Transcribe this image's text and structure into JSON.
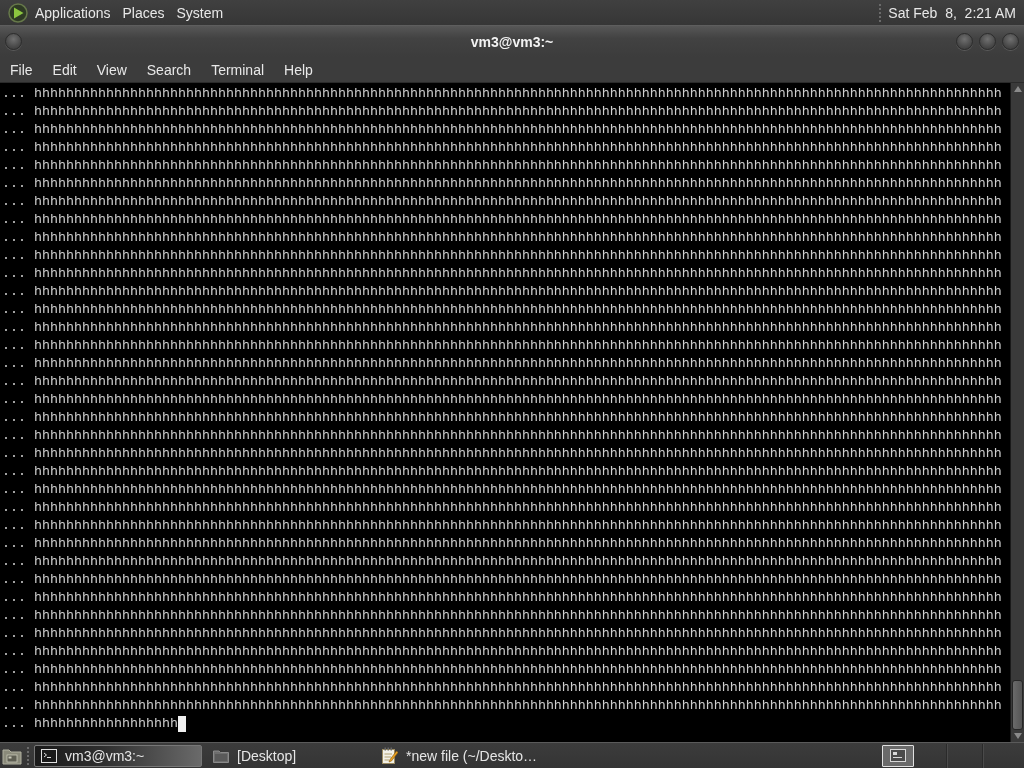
{
  "top_panel": {
    "menus": [
      "Applications",
      "Places",
      "System"
    ],
    "clock": "Sat Feb  8,  2:21 AM"
  },
  "window": {
    "title": "vm3@vm3:~"
  },
  "menu_bar": [
    "File",
    "Edit",
    "View",
    "Search",
    "Terminal",
    "Help"
  ],
  "terminal": {
    "lines": [
      {
        "text": "... hhhhhhhhhhhhhhhhhhhhhhhhhhhhhhhhhhhhhhhhhhhhhhhhhhhhhhhhhhhhhhhhhhhhhhhhhhhhhhhhhhhhhhhhhhhhhhhhhhhhhhhhhhhhhhhhhhhhhhhhh",
        "cursor": false
      },
      {
        "text": "... hhhhhhhhhhhhhhhhhhhhhhhhhhhhhhhhhhhhhhhhhhhhhhhhhhhhhhhhhhhhhhhhhhhhhhhhhhhhhhhhhhhhhhhhhhhhhhhhhhhhhhhhhhhhhhhhhhhhhhhhh",
        "cursor": false
      },
      {
        "text": "... hhhhhhhhhhhhhhhhhhhhhhhhhhhhhhhhhhhhhhhhhhhhhhhhhhhhhhhhhhhhhhhhhhhhhhhhhhhhhhhhhhhhhhhhhhhhhhhhhhhhhhhhhhhhhhhhhhhhhhhhh",
        "cursor": false
      },
      {
        "text": "... hhhhhhhhhhhhhhhhhhhhhhhhhhhhhhhhhhhhhhhhhhhhhhhhhhhhhhhhhhhhhhhhhhhhhhhhhhhhhhhhhhhhhhhhhhhhhhhhhhhhhhhhhhhhhhhhhhhhhhhhh",
        "cursor": false
      },
      {
        "text": "... hhhhhhhhhhhhhhhhhhhhhhhhhhhhhhhhhhhhhhhhhhhhhhhhhhhhhhhhhhhhhhhhhhhhhhhhhhhhhhhhhhhhhhhhhhhhhhhhhhhhhhhhhhhhhhhhhhhhhhhhh",
        "cursor": false
      },
      {
        "text": "... hhhhhhhhhhhhhhhhhhhhhhhhhhhhhhhhhhhhhhhhhhhhhhhhhhhhhhhhhhhhhhhhhhhhhhhhhhhhhhhhhhhhhhhhhhhhhhhhhhhhhhhhhhhhhhhhhhhhhhhhh",
        "cursor": false
      },
      {
        "text": "... hhhhhhhhhhhhhhhhhhhhhhhhhhhhhhhhhhhhhhhhhhhhhhhhhhhhhhhhhhhhhhhhhhhhhhhhhhhhhhhhhhhhhhhhhhhhhhhhhhhhhhhhhhhhhhhhhhhhhhhhh",
        "cursor": false
      },
      {
        "text": "... hhhhhhhhhhhhhhhhhhhhhhhhhhhhhhhhhhhhhhhhhhhhhhhhhhhhhhhhhhhhhhhhhhhhhhhhhhhhhhhhhhhhhhhhhhhhhhhhhhhhhhhhhhhhhhhhhhhhhhhhh",
        "cursor": false
      },
      {
        "text": "... hhhhhhhhhhhhhhhhhhhhhhhhhhhhhhhhhhhhhhhhhhhhhhhhhhhhhhhhhhhhhhhhhhhhhhhhhhhhhhhhhhhhhhhhhhhhhhhhhhhhhhhhhhhhhhhhhhhhhhhhh",
        "cursor": false
      },
      {
        "text": "... hhhhhhhhhhhhhhhhhhhhhhhhhhhhhhhhhhhhhhhhhhhhhhhhhhhhhhhhhhhhhhhhhhhhhhhhhhhhhhhhhhhhhhhhhhhhhhhhhhhhhhhhhhhhhhhhhhhhhhhhh",
        "cursor": false
      },
      {
        "text": "... hhhhhhhhhhhhhhhhhhhhhhhhhhhhhhhhhhhhhhhhhhhhhhhhhhhhhhhhhhhhhhhhhhhhhhhhhhhhhhhhhhhhhhhhhhhhhhhhhhhhhhhhhhhhhhhhhhhhhhhhh",
        "cursor": false
      },
      {
        "text": "... hhhhhhhhhhhhhhhhhhhhhhhhhhhhhhhhhhhhhhhhhhhhhhhhhhhhhhhhhhhhhhhhhhhhhhhhhhhhhhhhhhhhhhhhhhhhhhhhhhhhhhhhhhhhhhhhhhhhhhhhh",
        "cursor": false
      },
      {
        "text": "... hhhhhhhhhhhhhhhhhhhhhhhhhhhhhhhhhhhhhhhhhhhhhhhhhhhhhhhhhhhhhhhhhhhhhhhhhhhhhhhhhhhhhhhhhhhhhhhhhhhhhhhhhhhhhhhhhhhhhhhhh",
        "cursor": false
      },
      {
        "text": "... hhhhhhhhhhhhhhhhhhhhhhhhhhhhhhhhhhhhhhhhhhhhhhhhhhhhhhhhhhhhhhhhhhhhhhhhhhhhhhhhhhhhhhhhhhhhhhhhhhhhhhhhhhhhhhhhhhhhhhhhh",
        "cursor": false
      },
      {
        "text": "... hhhhhhhhhhhhhhhhhhhhhhhhhhhhhhhhhhhhhhhhhhhhhhhhhhhhhhhhhhhhhhhhhhhhhhhhhhhhhhhhhhhhhhhhhhhhhhhhhhhhhhhhhhhhhhhhhhhhhhhhh",
        "cursor": false
      },
      {
        "text": "... hhhhhhhhhhhhhhhhhhhhhhhhhhhhhhhhhhhhhhhhhhhhhhhhhhhhhhhhhhhhhhhhhhhhhhhhhhhhhhhhhhhhhhhhhhhhhhhhhhhhhhhhhhhhhhhhhhhhhhhhh",
        "cursor": false
      },
      {
        "text": "... hhhhhhhhhhhhhhhhhhhhhhhhhhhhhhhhhhhhhhhhhhhhhhhhhhhhhhhhhhhhhhhhhhhhhhhhhhhhhhhhhhhhhhhhhhhhhhhhhhhhhhhhhhhhhhhhhhhhhhhhh",
        "cursor": false
      },
      {
        "text": "... hhhhhhhhhhhhhhhhhhhhhhhhhhhhhhhhhhhhhhhhhhhhhhhhhhhhhhhhhhhhhhhhhhhhhhhhhhhhhhhhhhhhhhhhhhhhhhhhhhhhhhhhhhhhhhhhhhhhhhhhh",
        "cursor": false
      },
      {
        "text": "... hhhhhhhhhhhhhhhhhhhhhhhhhhhhhhhhhhhhhhhhhhhhhhhhhhhhhhhhhhhhhhhhhhhhhhhhhhhhhhhhhhhhhhhhhhhhhhhhhhhhhhhhhhhhhhhhhhhhhhhhh",
        "cursor": false
      },
      {
        "text": "... hhhhhhhhhhhhhhhhhhhhhhhhhhhhhhhhhhhhhhhhhhhhhhhhhhhhhhhhhhhhhhhhhhhhhhhhhhhhhhhhhhhhhhhhhhhhhhhhhhhhhhhhhhhhhhhhhhhhhhhhh",
        "cursor": false
      },
      {
        "text": "... hhhhhhhhhhhhhhhhhhhhhhhhhhhhhhhhhhhhhhhhhhhhhhhhhhhhhhhhhhhhhhhhhhhhhhhhhhhhhhhhhhhhhhhhhhhhhhhhhhhhhhhhhhhhhhhhhhhhhhhhh",
        "cursor": false
      },
      {
        "text": "... hhhhhhhhhhhhhhhhhhhhhhhhhhhhhhhhhhhhhhhhhhhhhhhhhhhhhhhhhhhhhhhhhhhhhhhhhhhhhhhhhhhhhhhhhhhhhhhhhhhhhhhhhhhhhhhhhhhhhhhhh",
        "cursor": false
      },
      {
        "text": "... hhhhhhhhhhhhhhhhhhhhhhhhhhhhhhhhhhhhhhhhhhhhhhhhhhhhhhhhhhhhhhhhhhhhhhhhhhhhhhhhhhhhhhhhhhhhhhhhhhhhhhhhhhhhhhhhhhhhhhhhh",
        "cursor": false
      },
      {
        "text": "... hhhhhhhhhhhhhhhhhhhhhhhhhhhhhhhhhhhhhhhhhhhhhhhhhhhhhhhhhhhhhhhhhhhhhhhhhhhhhhhhhhhhhhhhhhhhhhhhhhhhhhhhhhhhhhhhhhhhhhhhh",
        "cursor": false
      },
      {
        "text": "... hhhhhhhhhhhhhhhhhhhhhhhhhhhhhhhhhhhhhhhhhhhhhhhhhhhhhhhhhhhhhhhhhhhhhhhhhhhhhhhhhhhhhhhhhhhhhhhhhhhhhhhhhhhhhhhhhhhhhhhhh",
        "cursor": false
      },
      {
        "text": "... hhhhhhhhhhhhhhhhhhhhhhhhhhhhhhhhhhhhhhhhhhhhhhhhhhhhhhhhhhhhhhhhhhhhhhhhhhhhhhhhhhhhhhhhhhhhhhhhhhhhhhhhhhhhhhhhhhhhhhhhh",
        "cursor": false
      },
      {
        "text": "... hhhhhhhhhhhhhhhhhhhhhhhhhhhhhhhhhhhhhhhhhhhhhhhhhhhhhhhhhhhhhhhhhhhhhhhhhhhhhhhhhhhhhhhhhhhhhhhhhhhhhhhhhhhhhhhhhhhhhhhhh",
        "cursor": false
      },
      {
        "text": "... hhhhhhhhhhhhhhhhhhhhhhhhhhhhhhhhhhhhhhhhhhhhhhhhhhhhhhhhhhhhhhhhhhhhhhhhhhhhhhhhhhhhhhhhhhhhhhhhhhhhhhhhhhhhhhhhhhhhhhhhh",
        "cursor": false
      },
      {
        "text": "... hhhhhhhhhhhhhhhhhhhhhhhhhhhhhhhhhhhhhhhhhhhhhhhhhhhhhhhhhhhhhhhhhhhhhhhhhhhhhhhhhhhhhhhhhhhhhhhhhhhhhhhhhhhhhhhhhhhhhhhhh",
        "cursor": false
      },
      {
        "text": "... hhhhhhhhhhhhhhhhhhhhhhhhhhhhhhhhhhhhhhhhhhhhhhhhhhhhhhhhhhhhhhhhhhhhhhhhhhhhhhhhhhhhhhhhhhhhhhhhhhhhhhhhhhhhhhhhhhhhhhhhh",
        "cursor": false
      },
      {
        "text": "... hhhhhhhhhhhhhhhhhhhhhhhhhhhhhhhhhhhhhhhhhhhhhhhhhhhhhhhhhhhhhhhhhhhhhhhhhhhhhhhhhhhhhhhhhhhhhhhhhhhhhhhhhhhhhhhhhhhhhhhhh",
        "cursor": false
      },
      {
        "text": "... hhhhhhhhhhhhhhhhhhhhhhhhhhhhhhhhhhhhhhhhhhhhhhhhhhhhhhhhhhhhhhhhhhhhhhhhhhhhhhhhhhhhhhhhhhhhhhhhhhhhhhhhhhhhhhhhhhhhhhhhh",
        "cursor": false
      },
      {
        "text": "... hhhhhhhhhhhhhhhhhhhhhhhhhhhhhhhhhhhhhhhhhhhhhhhhhhhhhhhhhhhhhhhhhhhhhhhhhhhhhhhhhhhhhhhhhhhhhhhhhhhhhhhhhhhhhhhhhhhhhhhhh",
        "cursor": false
      },
      {
        "text": "... hhhhhhhhhhhhhhhhhhhhhhhhhhhhhhhhhhhhhhhhhhhhhhhhhhhhhhhhhhhhhhhhhhhhhhhhhhhhhhhhhhhhhhhhhhhhhhhhhhhhhhhhhhhhhhhhhhhhhhhhh",
        "cursor": false
      },
      {
        "text": "... hhhhhhhhhhhhhhhhhhhhhhhhhhhhhhhhhhhhhhhhhhhhhhhhhhhhhhhhhhhhhhhhhhhhhhhhhhhhhhhhhhhhhhhhhhhhhhhhhhhhhhhhhhhhhhhhhhhhhhhhh",
        "cursor": false
      },
      {
        "text": "... hhhhhhhhhhhhhhhhhh",
        "cursor": true
      }
    ]
  },
  "taskbar": {
    "tasks": [
      {
        "kind": "terminal",
        "label": "vm3@vm3:~",
        "selected": true
      },
      {
        "kind": "folder",
        "label": "[Desktop]",
        "selected": false
      },
      {
        "kind": "editor",
        "label": "*new file (~/Deskto…",
        "selected": false
      }
    ],
    "workspaces": [
      {
        "selected": true
      }
    ]
  }
}
